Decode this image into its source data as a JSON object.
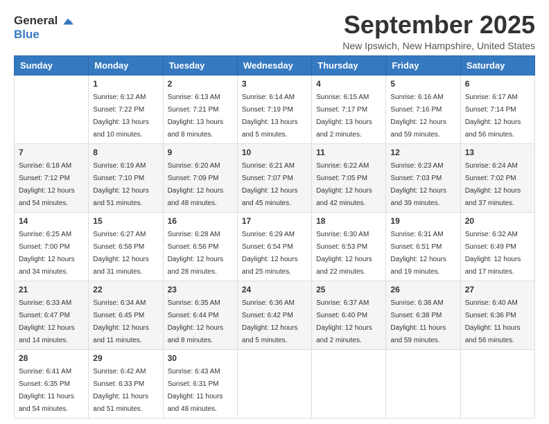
{
  "logo": {
    "line1": "General",
    "line2": "Blue"
  },
  "title": "September 2025",
  "location": "New Ipswich, New Hampshire, United States",
  "days_of_week": [
    "Sunday",
    "Monday",
    "Tuesday",
    "Wednesday",
    "Thursday",
    "Friday",
    "Saturday"
  ],
  "weeks": [
    [
      {
        "day": "",
        "sunrise": "",
        "sunset": "",
        "daylight": ""
      },
      {
        "day": "1",
        "sunrise": "Sunrise: 6:12 AM",
        "sunset": "Sunset: 7:22 PM",
        "daylight": "Daylight: 13 hours and 10 minutes."
      },
      {
        "day": "2",
        "sunrise": "Sunrise: 6:13 AM",
        "sunset": "Sunset: 7:21 PM",
        "daylight": "Daylight: 13 hours and 8 minutes."
      },
      {
        "day": "3",
        "sunrise": "Sunrise: 6:14 AM",
        "sunset": "Sunset: 7:19 PM",
        "daylight": "Daylight: 13 hours and 5 minutes."
      },
      {
        "day": "4",
        "sunrise": "Sunrise: 6:15 AM",
        "sunset": "Sunset: 7:17 PM",
        "daylight": "Daylight: 13 hours and 2 minutes."
      },
      {
        "day": "5",
        "sunrise": "Sunrise: 6:16 AM",
        "sunset": "Sunset: 7:16 PM",
        "daylight": "Daylight: 12 hours and 59 minutes."
      },
      {
        "day": "6",
        "sunrise": "Sunrise: 6:17 AM",
        "sunset": "Sunset: 7:14 PM",
        "daylight": "Daylight: 12 hours and 56 minutes."
      }
    ],
    [
      {
        "day": "7",
        "sunrise": "Sunrise: 6:18 AM",
        "sunset": "Sunset: 7:12 PM",
        "daylight": "Daylight: 12 hours and 54 minutes."
      },
      {
        "day": "8",
        "sunrise": "Sunrise: 6:19 AM",
        "sunset": "Sunset: 7:10 PM",
        "daylight": "Daylight: 12 hours and 51 minutes."
      },
      {
        "day": "9",
        "sunrise": "Sunrise: 6:20 AM",
        "sunset": "Sunset: 7:09 PM",
        "daylight": "Daylight: 12 hours and 48 minutes."
      },
      {
        "day": "10",
        "sunrise": "Sunrise: 6:21 AM",
        "sunset": "Sunset: 7:07 PM",
        "daylight": "Daylight: 12 hours and 45 minutes."
      },
      {
        "day": "11",
        "sunrise": "Sunrise: 6:22 AM",
        "sunset": "Sunset: 7:05 PM",
        "daylight": "Daylight: 12 hours and 42 minutes."
      },
      {
        "day": "12",
        "sunrise": "Sunrise: 6:23 AM",
        "sunset": "Sunset: 7:03 PM",
        "daylight": "Daylight: 12 hours and 39 minutes."
      },
      {
        "day": "13",
        "sunrise": "Sunrise: 6:24 AM",
        "sunset": "Sunset: 7:02 PM",
        "daylight": "Daylight: 12 hours and 37 minutes."
      }
    ],
    [
      {
        "day": "14",
        "sunrise": "Sunrise: 6:25 AM",
        "sunset": "Sunset: 7:00 PM",
        "daylight": "Daylight: 12 hours and 34 minutes."
      },
      {
        "day": "15",
        "sunrise": "Sunrise: 6:27 AM",
        "sunset": "Sunset: 6:58 PM",
        "daylight": "Daylight: 12 hours and 31 minutes."
      },
      {
        "day": "16",
        "sunrise": "Sunrise: 6:28 AM",
        "sunset": "Sunset: 6:56 PM",
        "daylight": "Daylight: 12 hours and 28 minutes."
      },
      {
        "day": "17",
        "sunrise": "Sunrise: 6:29 AM",
        "sunset": "Sunset: 6:54 PM",
        "daylight": "Daylight: 12 hours and 25 minutes."
      },
      {
        "day": "18",
        "sunrise": "Sunrise: 6:30 AM",
        "sunset": "Sunset: 6:53 PM",
        "daylight": "Daylight: 12 hours and 22 minutes."
      },
      {
        "day": "19",
        "sunrise": "Sunrise: 6:31 AM",
        "sunset": "Sunset: 6:51 PM",
        "daylight": "Daylight: 12 hours and 19 minutes."
      },
      {
        "day": "20",
        "sunrise": "Sunrise: 6:32 AM",
        "sunset": "Sunset: 6:49 PM",
        "daylight": "Daylight: 12 hours and 17 minutes."
      }
    ],
    [
      {
        "day": "21",
        "sunrise": "Sunrise: 6:33 AM",
        "sunset": "Sunset: 6:47 PM",
        "daylight": "Daylight: 12 hours and 14 minutes."
      },
      {
        "day": "22",
        "sunrise": "Sunrise: 6:34 AM",
        "sunset": "Sunset: 6:45 PM",
        "daylight": "Daylight: 12 hours and 11 minutes."
      },
      {
        "day": "23",
        "sunrise": "Sunrise: 6:35 AM",
        "sunset": "Sunset: 6:44 PM",
        "daylight": "Daylight: 12 hours and 8 minutes."
      },
      {
        "day": "24",
        "sunrise": "Sunrise: 6:36 AM",
        "sunset": "Sunset: 6:42 PM",
        "daylight": "Daylight: 12 hours and 5 minutes."
      },
      {
        "day": "25",
        "sunrise": "Sunrise: 6:37 AM",
        "sunset": "Sunset: 6:40 PM",
        "daylight": "Daylight: 12 hours and 2 minutes."
      },
      {
        "day": "26",
        "sunrise": "Sunrise: 6:38 AM",
        "sunset": "Sunset: 6:38 PM",
        "daylight": "Daylight: 11 hours and 59 minutes."
      },
      {
        "day": "27",
        "sunrise": "Sunrise: 6:40 AM",
        "sunset": "Sunset: 6:36 PM",
        "daylight": "Daylight: 11 hours and 56 minutes."
      }
    ],
    [
      {
        "day": "28",
        "sunrise": "Sunrise: 6:41 AM",
        "sunset": "Sunset: 6:35 PM",
        "daylight": "Daylight: 11 hours and 54 minutes."
      },
      {
        "day": "29",
        "sunrise": "Sunrise: 6:42 AM",
        "sunset": "Sunset: 6:33 PM",
        "daylight": "Daylight: 11 hours and 51 minutes."
      },
      {
        "day": "30",
        "sunrise": "Sunrise: 6:43 AM",
        "sunset": "Sunset: 6:31 PM",
        "daylight": "Daylight: 11 hours and 48 minutes."
      },
      {
        "day": "",
        "sunrise": "",
        "sunset": "",
        "daylight": ""
      },
      {
        "day": "",
        "sunrise": "",
        "sunset": "",
        "daylight": ""
      },
      {
        "day": "",
        "sunrise": "",
        "sunset": "",
        "daylight": ""
      },
      {
        "day": "",
        "sunrise": "",
        "sunset": "",
        "daylight": ""
      }
    ]
  ]
}
